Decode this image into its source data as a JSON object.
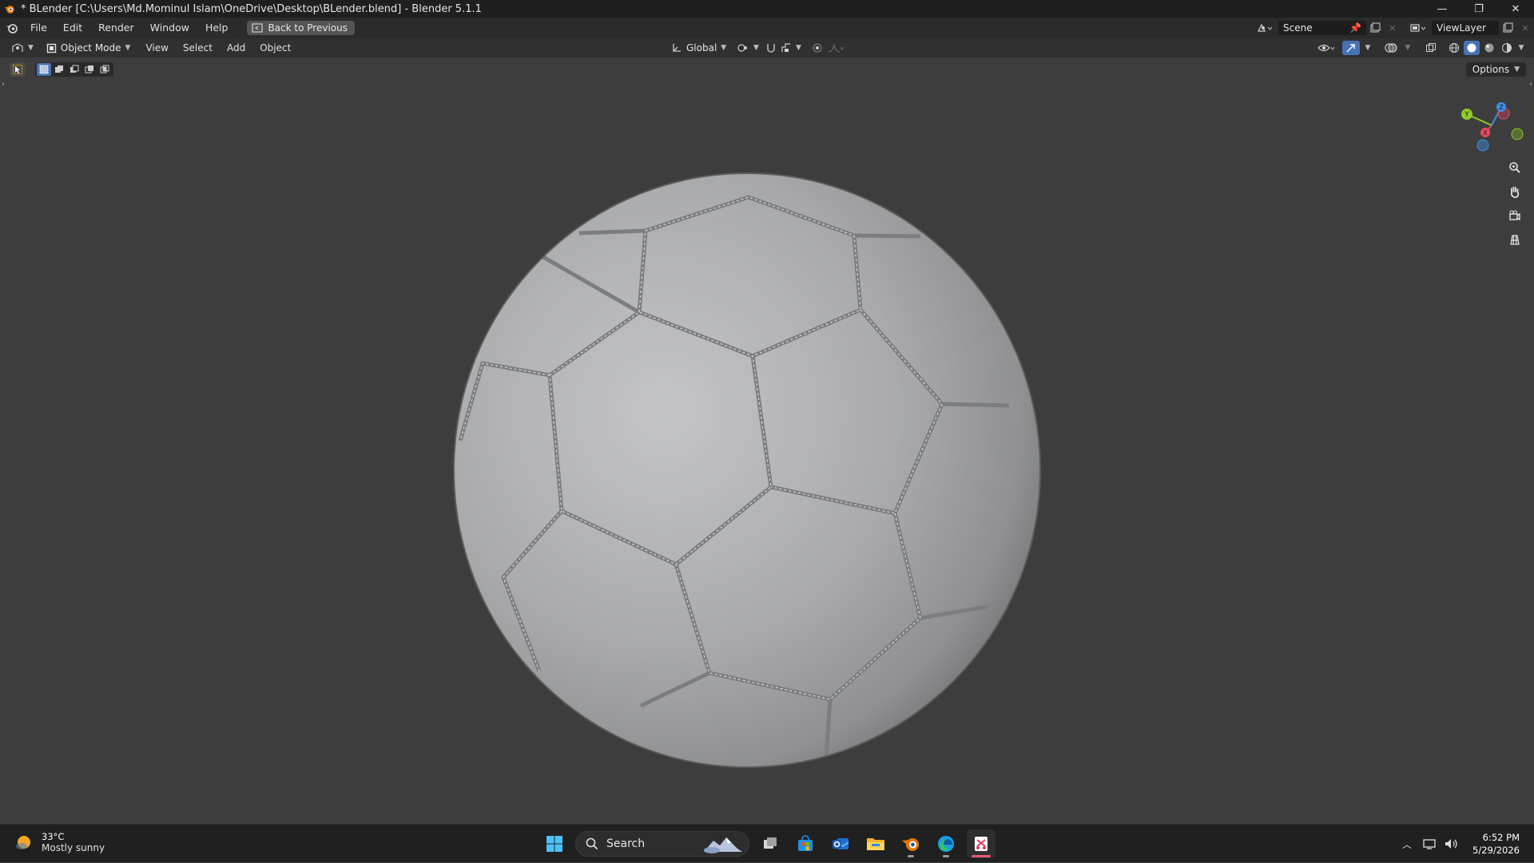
{
  "window": {
    "title": "* BLender [C:\\Users\\Md.Mominul Islam\\OneDrive\\Desktop\\BLender.blend] - Blender 5.1.1",
    "controls": [
      "minimize",
      "restore",
      "close"
    ]
  },
  "menubar": {
    "items": [
      "File",
      "Edit",
      "Render",
      "Window",
      "Help"
    ],
    "back_button": "Back to Previous",
    "scene": "Scene",
    "view_layer": "ViewLayer"
  },
  "viewport_header": {
    "mode": "Object Mode",
    "menus": [
      "View",
      "Select",
      "Add",
      "Object"
    ],
    "transform_orientation": "Global",
    "options": "Options",
    "shading_active": "solid"
  },
  "gizmo": {
    "axes": [
      "X",
      "Y",
      "Z"
    ],
    "colors": {
      "x": "#e84a5f",
      "y": "#8fcc27",
      "z": "#3d8ee6"
    }
  },
  "navigation": [
    "zoom-icon",
    "pan-hand-icon",
    "camera-icon",
    "grid-ortho-icon"
  ],
  "viewport_object": "soccer-ball",
  "colors": {
    "titlebar": "#1f1f1f",
    "menubar": "#2b2b2b",
    "header": "#303030",
    "viewport_bg": "#3d3d3d",
    "ball": "#a8a8a8",
    "accent_blue": "#4772b3"
  },
  "taskbar": {
    "weather": {
      "temp": "33°C",
      "desc": "Mostly sunny"
    },
    "search_placeholder": "Search",
    "apps": [
      "windows-start-icon",
      "search",
      "task-view-icon",
      "store-icon",
      "outlook-icon",
      "file-explorer-icon",
      "blender-icon",
      "edge-icon",
      "snipping-tool-icon"
    ],
    "clock": {
      "time": "6:52 PM",
      "date": "5/29/2026"
    }
  }
}
